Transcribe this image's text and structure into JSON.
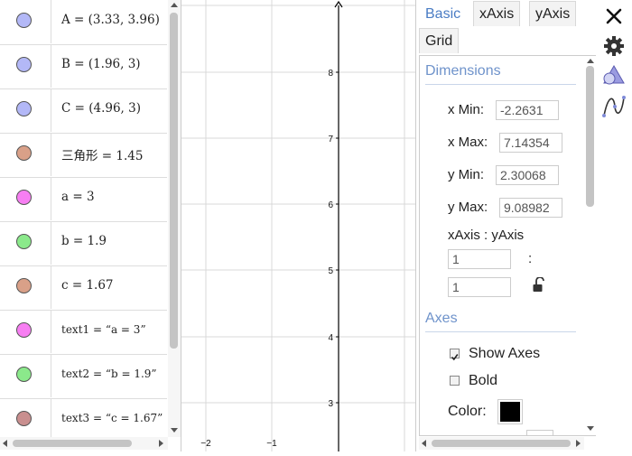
{
  "algebra": {
    "items": [
      {
        "text": "A = (3.33, 3.96)",
        "color": "#b3b8f7",
        "small": false
      },
      {
        "text": "B = (1.96, 3)",
        "color": "#b3b8f7",
        "small": false
      },
      {
        "text": "C = (4.96, 3)",
        "color": "#b3b8f7",
        "small": false
      },
      {
        "text": "三角形 = 1.45",
        "color": "#d9a088",
        "small": false
      },
      {
        "text": "a = 3",
        "color": "#f77ef2",
        "small": false
      },
      {
        "text": "b = 1.9",
        "color": "#8be98b",
        "small": false
      },
      {
        "text": "c = 1.67",
        "color": "#d9a088",
        "small": false
      },
      {
        "text": "text1 = “a = 3”",
        "color": "#f77ef2",
        "small": true
      },
      {
        "text": "text2 = “b = 1.9”",
        "color": "#8be98b",
        "small": true
      },
      {
        "text": "text3 = “c = 1.67”",
        "color": "#c98f8f",
        "small": true
      }
    ]
  },
  "graphics": {
    "y_ticks": [
      "8",
      "7",
      "6",
      "5",
      "4",
      "3"
    ],
    "x_ticks": [
      "−2",
      "−1"
    ]
  },
  "settings": {
    "tabs": {
      "basic": "Basic",
      "xaxis": "xAxis",
      "yaxis": "yAxis",
      "grid": "Grid"
    },
    "dimensions": {
      "title": "Dimensions",
      "xmin_label": "x Min:",
      "xmin_value": "-2.2631",
      "xmax_label": "x Max:",
      "xmax_value": "7.14354",
      "ymin_label": "y Min:",
      "ymin_value": "2.30068",
      "ymax_label": "y Max:",
      "ymax_value": "9.08982",
      "ratio_label": "xAxis : yAxis",
      "ratio_x": "1",
      "ratio_sep": ":",
      "ratio_y": "1"
    },
    "axes": {
      "title": "Axes",
      "show_axes_label": "Show Axes",
      "show_axes_checked": true,
      "bold_label": "Bold",
      "bold_checked": false,
      "color_label": "Color:",
      "color_value": "#000000"
    }
  },
  "toolbar": {
    "icons": [
      "close-icon",
      "gear-icon",
      "geometry-shapes-icon",
      "function-graph-icon"
    ]
  }
}
